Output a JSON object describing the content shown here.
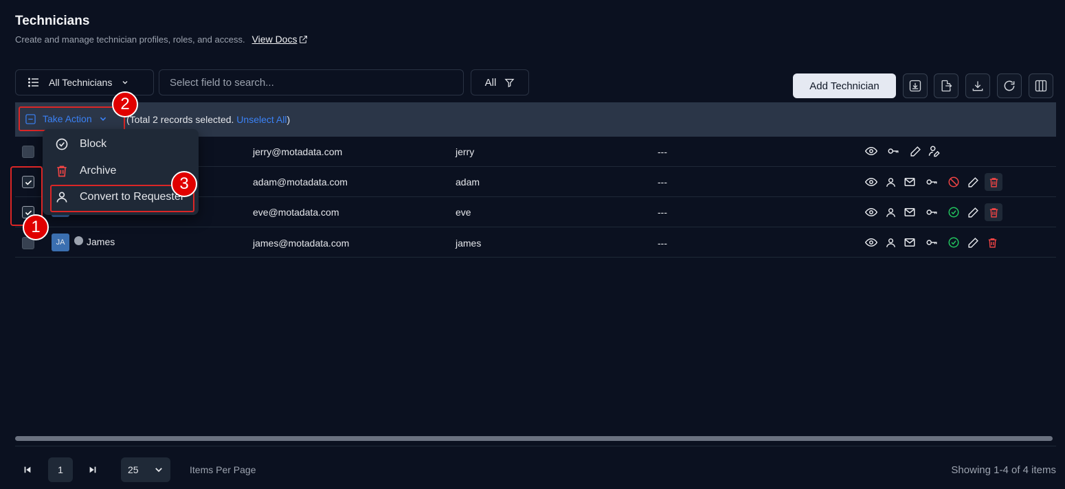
{
  "header": {
    "title": "Technicians",
    "subtitle": "Create and manage technician profiles, roles, and access.",
    "view_docs": "View Docs"
  },
  "toolbar": {
    "view_label": "All Technicians",
    "search_placeholder": "Select field to search...",
    "filter_label": "All",
    "add_label": "Add Technician"
  },
  "selection": {
    "take_action": "Take Action",
    "selected_text": "(Total 2 records selected. ",
    "unselect_all": "Unselect All",
    "close_paren": ")"
  },
  "dropdown": {
    "items": [
      "Block",
      "Archive",
      "Convert to Requester"
    ]
  },
  "rows": [
    {
      "email": "jerry@motadata.com",
      "username": "jerry",
      "extra": "---",
      "checked": false
    },
    {
      "email": "adam@motadata.com",
      "username": "adam",
      "extra": "---",
      "checked": true
    },
    {
      "email": "eve@motadata.com",
      "username": "eve",
      "extra": "---",
      "checked": true
    },
    {
      "initials": "JA",
      "name": "James",
      "email": "james@motadata.com",
      "username": "james",
      "extra": "---",
      "checked": false
    }
  ],
  "annotations": [
    "1",
    "2",
    "3"
  ],
  "pagination": {
    "page": "1",
    "per_page": "25",
    "per_page_label": "Items Per Page",
    "showing": "Showing 1-4 of 4 items"
  },
  "colors": {
    "background": "#0b1120",
    "accent": "#3b82f6",
    "highlight": "#dc2626",
    "danger": "#ef4444",
    "success": "#22c55e"
  }
}
